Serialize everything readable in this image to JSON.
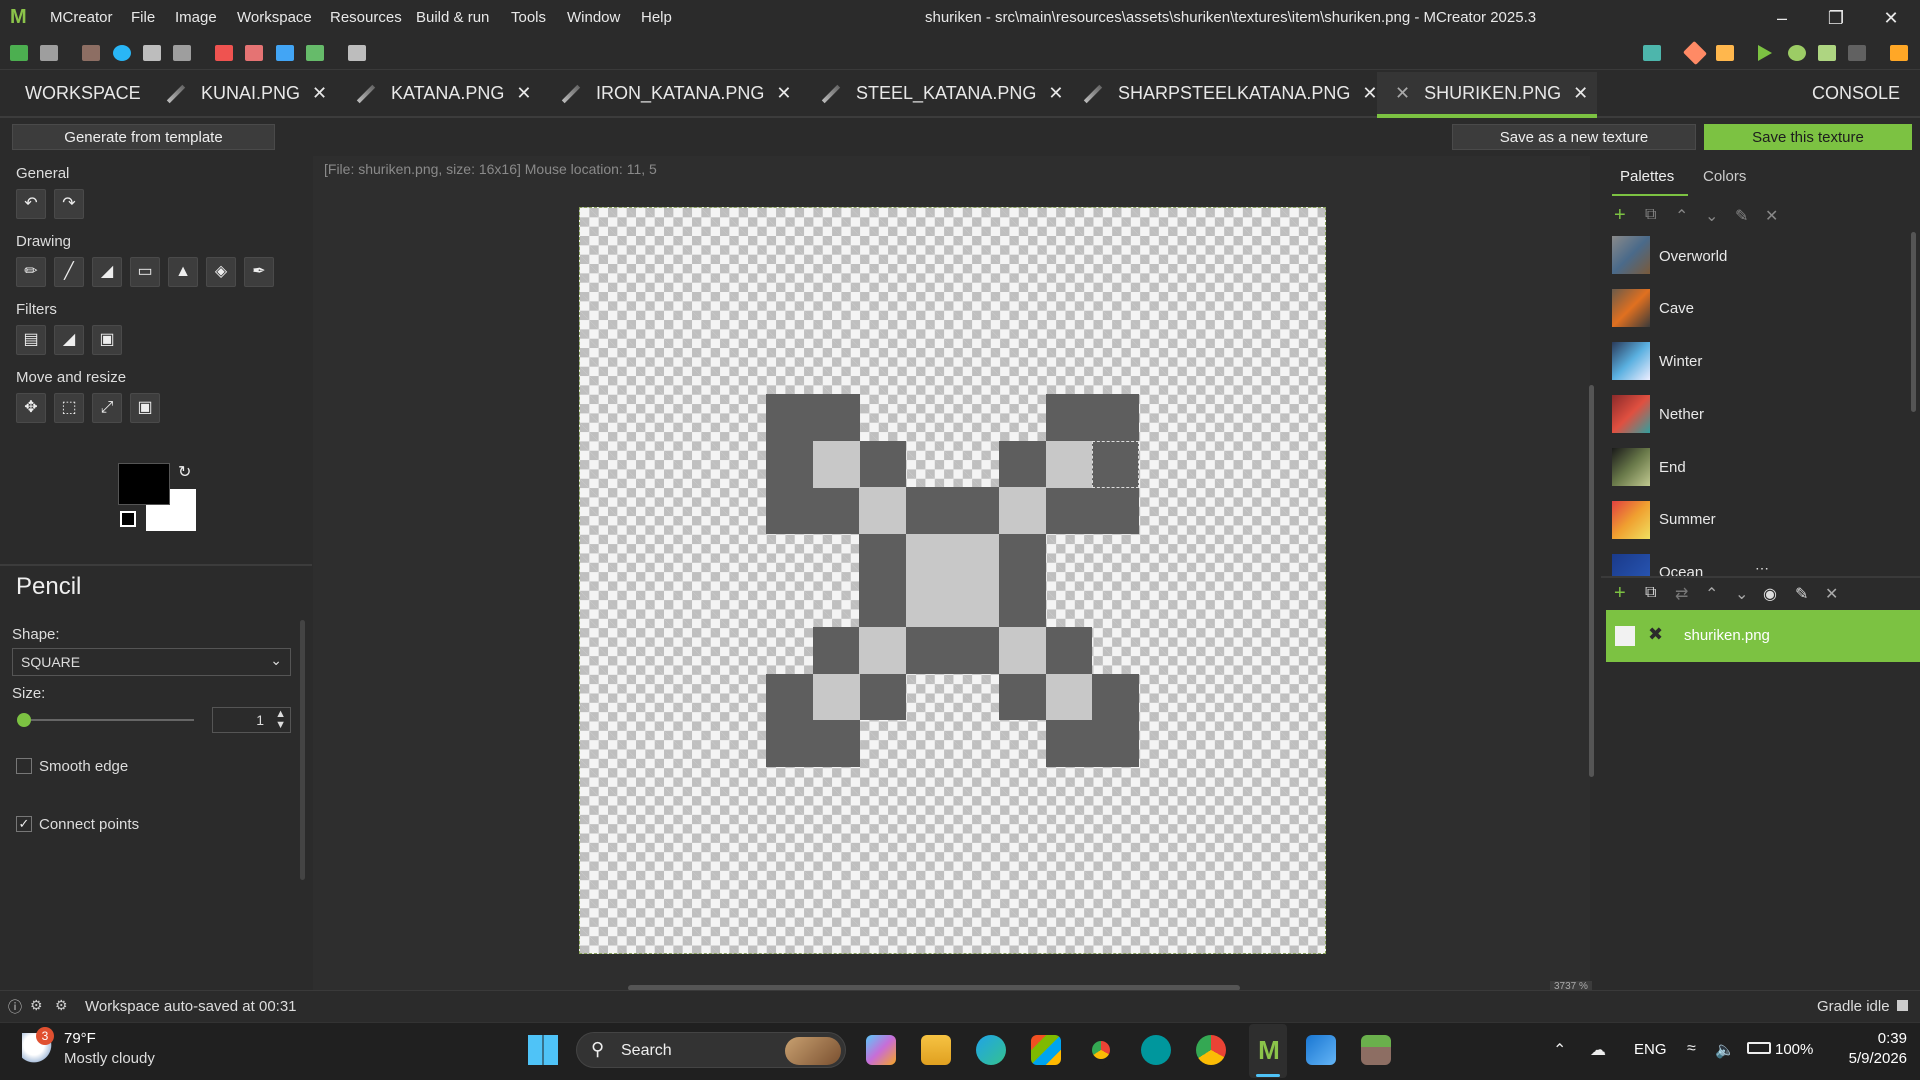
{
  "app": {
    "logo": "M",
    "window_title": "shuriken - src\\main\\resources\\assets\\shuriken\\textures\\item\\shuriken.png - MCreator 2025.3"
  },
  "menu": [
    "MCreator",
    "File",
    "Image",
    "Workspace",
    "Resources",
    "Build & run",
    "Tools",
    "Window",
    "Help"
  ],
  "tabs": {
    "workspace": "WORKSPACE",
    "items": [
      "KUNAI.PNG",
      "KATANA.PNG",
      "IRON_KATANA.PNG",
      "STEEL_KATANA.PNG",
      "SHARPSTEELKATANA.PNG",
      "SHURIKEN.PNG"
    ],
    "console": "CONSOLE"
  },
  "subbar": {
    "generate": "Generate from template",
    "save_new": "Save as a new texture",
    "save_this": "Save this texture"
  },
  "info_line": "[File: shuriken.png, size: 16x16] Mouse location: 11, 5",
  "left": {
    "general": "General",
    "drawing": "Drawing",
    "filters": "Filters",
    "move_resize": "Move and resize",
    "tool_title": "Pencil",
    "shape_label": "Shape:",
    "shape_value": "SQUARE",
    "size_label": "Size:",
    "size_value": "1",
    "smooth_edge": "Smooth edge",
    "connect_points": "Connect points",
    "smooth_checked": false,
    "connect_checked": true
  },
  "right": {
    "tabs": [
      "Palettes",
      "Colors"
    ],
    "palettes": [
      "Overworld",
      "Cave",
      "Winter",
      "Nether",
      "End",
      "Summer",
      "Ocean"
    ],
    "layer_name": "shuriken.png"
  },
  "zoom": "3737 %",
  "status": {
    "left": "Workspace auto-saved at 00:31",
    "right": "Gradle idle"
  },
  "taskbar": {
    "weather_temp": "79°F",
    "weather_desc": "Mostly cloudy",
    "weather_badge": "3",
    "search": "Search",
    "lang": "ENG",
    "battery": "100%",
    "time": "0:39",
    "date": "5/9/2026"
  },
  "colors": {
    "accent": "#7cc242",
    "dark_pixel": "#5e5e5e",
    "light_pixel": "#c8c8c8"
  }
}
